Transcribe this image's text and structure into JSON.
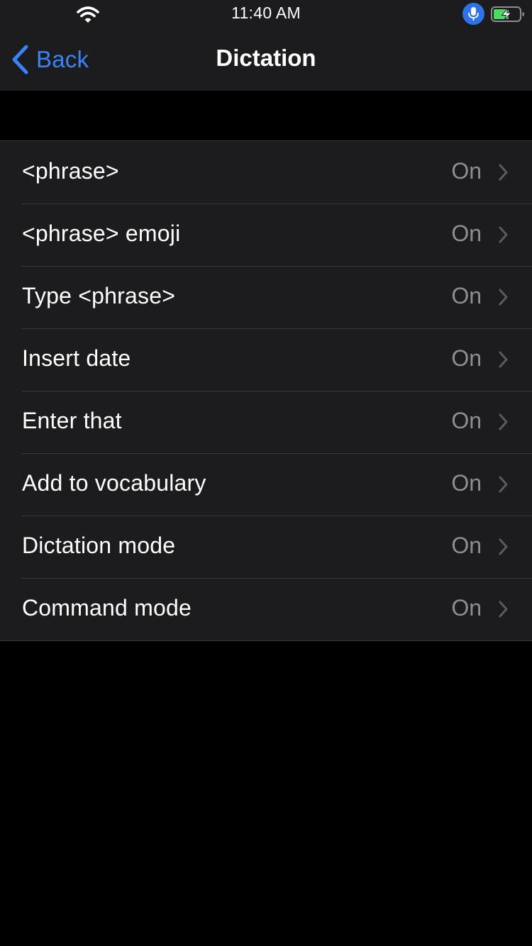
{
  "status_bar": {
    "time": "11:40 AM",
    "wifi_icon": "wifi-icon",
    "mic_icon": "microphone-icon",
    "battery_icon": "battery-charging-icon",
    "mic_color": "#2f72e6",
    "battery_color": "#4cd964"
  },
  "nav": {
    "back_label": "Back",
    "title": "Dictation",
    "accent_color": "#3a82f7"
  },
  "rows": [
    {
      "label": "<phrase>",
      "value": "On"
    },
    {
      "label": "<phrase> emoji",
      "value": "On"
    },
    {
      "label": "Type <phrase>",
      "value": "On"
    },
    {
      "label": "Insert date",
      "value": "On"
    },
    {
      "label": "Enter that",
      "value": "On"
    },
    {
      "label": "Add to vocabulary",
      "value": "On"
    },
    {
      "label": "Dictation mode",
      "value": "On"
    },
    {
      "label": "Command mode",
      "value": "On"
    }
  ]
}
